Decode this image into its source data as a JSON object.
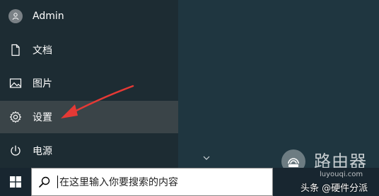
{
  "start_menu": {
    "items": [
      {
        "label": "Admin",
        "icon": "user-icon"
      },
      {
        "label": "文档",
        "icon": "document-icon"
      },
      {
        "label": "图片",
        "icon": "pictures-icon"
      },
      {
        "label": "设置",
        "icon": "gear-icon"
      },
      {
        "label": "电源",
        "icon": "power-icon"
      }
    ],
    "highlight_color": "#3a4448"
  },
  "taskbar": {
    "search_placeholder": "在这里输入你要搜索的内容",
    "start_icon": "windows-icon",
    "search_icon": "search-icon"
  },
  "annotation": {
    "arrow_color": "#e53935"
  },
  "watermark": {
    "name": "路由器",
    "url": "luyouqi.com",
    "credit": "头条 @硬件分派"
  }
}
